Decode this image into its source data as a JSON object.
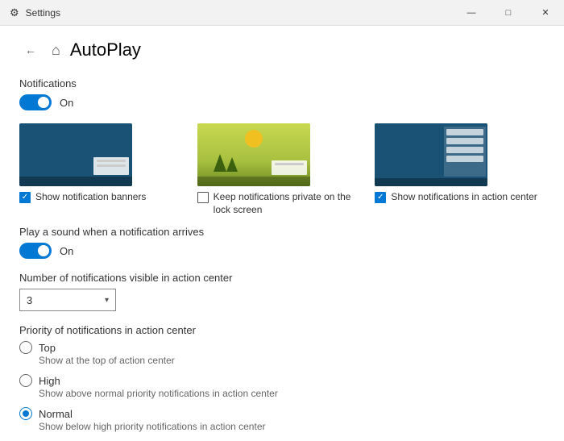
{
  "titlebar": {
    "title": "Settings",
    "minimize": "—",
    "maximize": "□",
    "close": "✕"
  },
  "header": {
    "home_icon": "⌂",
    "title": "AutoPlay"
  },
  "notifications": {
    "section_label": "Notifications",
    "toggle_label": "On",
    "previews": [
      {
        "type": "banners",
        "checkbox_label": "Show notification banners",
        "checked": true
      },
      {
        "type": "lock",
        "checkbox_label": "Keep notifications private on the lock screen",
        "checked": false
      },
      {
        "type": "action_center",
        "checkbox_label": "Show notifications in action center",
        "checked": true
      }
    ]
  },
  "sound": {
    "section_label": "Play a sound when a notification arrives",
    "toggle_label": "On"
  },
  "visible_count": {
    "section_label": "Number of notifications visible in action center",
    "value": "3"
  },
  "priority": {
    "section_label": "Priority of notifications in action center",
    "options": [
      {
        "label": "Top",
        "desc": "Show at the top of action center",
        "selected": false
      },
      {
        "label": "High",
        "desc": "Show above normal priority notifications in action center",
        "selected": false
      },
      {
        "label": "Normal",
        "desc": "Show below high priority notifications in action center",
        "selected": true
      }
    ]
  }
}
